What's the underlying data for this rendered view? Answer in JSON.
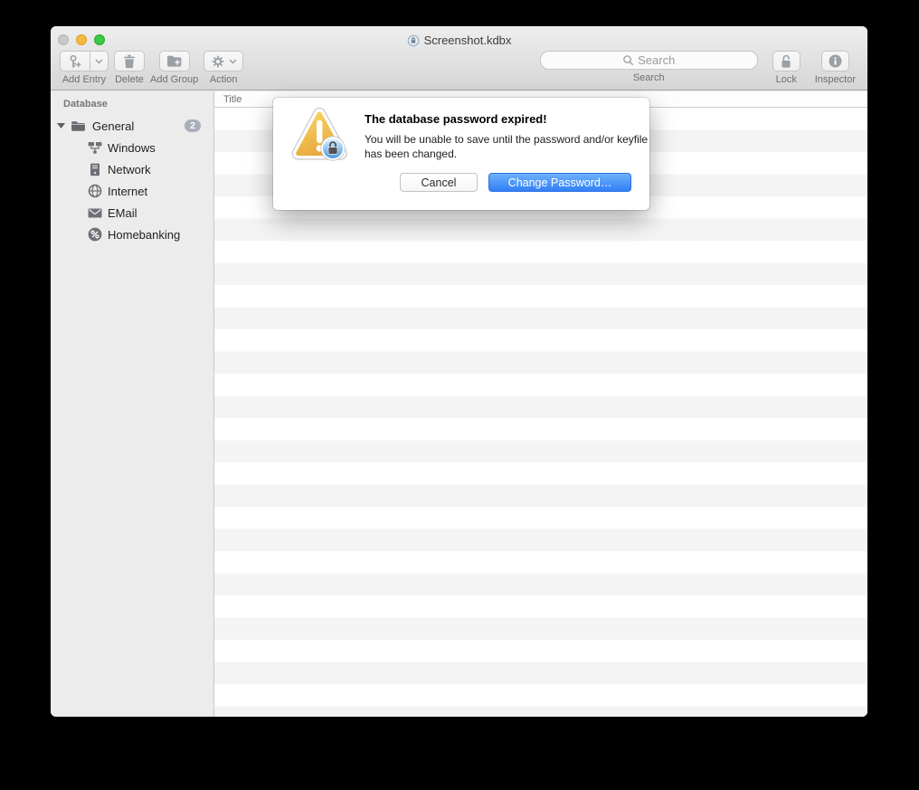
{
  "window_title": "Screenshot.kdbx",
  "toolbar": {
    "add_entry_label": "Add Entry",
    "delete_label": "Delete",
    "add_group_label": "Add Group",
    "action_label": "Action",
    "search_placeholder": "Search",
    "search_label": "Search",
    "lock_label": "Lock",
    "inspector_label": "Inspector"
  },
  "sidebar": {
    "header": "Database",
    "root_group": {
      "label": "General",
      "badge": "2"
    },
    "items": [
      {
        "label": "Windows",
        "icon": "windows-icon"
      },
      {
        "label": "Network",
        "icon": "server-icon"
      },
      {
        "label": "Internet",
        "icon": "globe-icon"
      },
      {
        "label": "EMail",
        "icon": "envelope-icon"
      },
      {
        "label": "Homebanking",
        "icon": "percent-icon"
      }
    ]
  },
  "entry_list": {
    "columns": [
      "Title"
    ]
  },
  "alert": {
    "title": "The database password expired!",
    "message": "You will be unable to save until the password and/or keyfile has been changed.",
    "cancel_label": "Cancel",
    "primary_label": "Change Password…"
  },
  "colors": {
    "accent_blue": "#3180f6",
    "warning_yellow": "#eeb13d",
    "badge_gray": "#a9b0ba",
    "traffic_close_disabled": "#c9c9c9",
    "traffic_minimize": "#f6b845",
    "traffic_zoom": "#3bc948"
  }
}
